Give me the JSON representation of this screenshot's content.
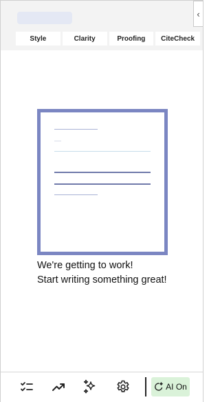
{
  "tabs": [
    {
      "label": "Style"
    },
    {
      "label": "Clarity"
    },
    {
      "label": "Proofing"
    },
    {
      "label": "CiteCheck"
    }
  ],
  "collapse": {
    "glyph": "‹"
  },
  "empty_state": {
    "line1": "We're getting to work!",
    "line2": "Start writing something great!"
  },
  "toolbar": {
    "icons": [
      "checklist-icon",
      "trending-up-icon",
      "sparkles-icon",
      "settings-gear-icon"
    ],
    "ai_toggle_label": "AI On"
  },
  "colors": {
    "accent_border": "#7b86c2",
    "ai_toggle_bg": "#daf2d9",
    "header_bg": "#f3f3f3"
  }
}
